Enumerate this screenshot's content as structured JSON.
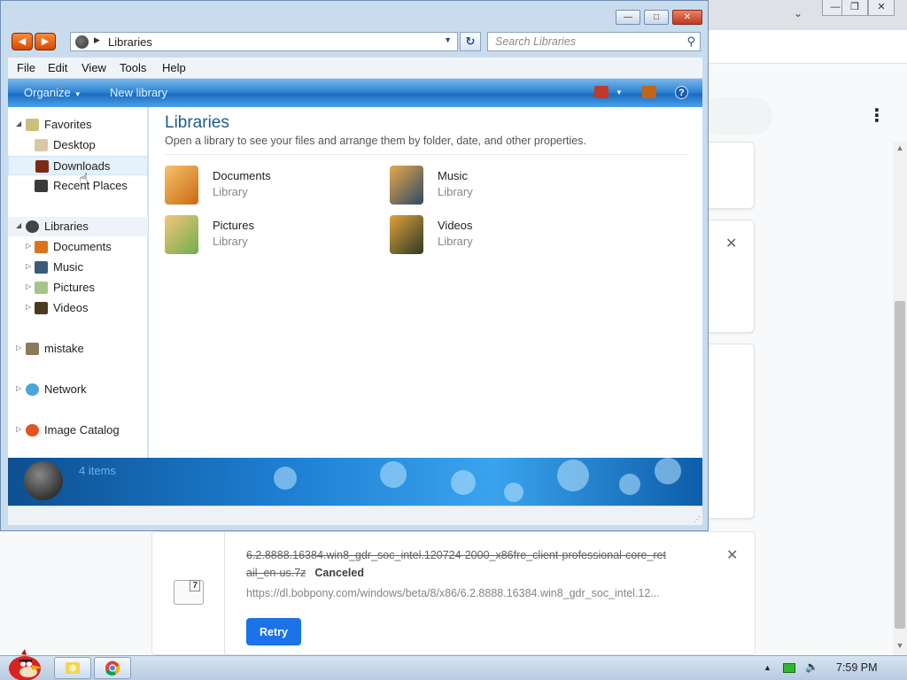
{
  "explorer": {
    "address": {
      "location": "Libraries"
    },
    "search": {
      "placeholder": "Search Libraries"
    },
    "menu": [
      "File",
      "Edit",
      "View",
      "Tools",
      "Help"
    ],
    "command_bar": {
      "organize": "Organize",
      "new_library": "New library"
    },
    "nav": {
      "favorites": "Favorites",
      "favorites_items": [
        "Desktop",
        "Downloads",
        "Recent Places"
      ],
      "libraries": "Libraries",
      "libraries_items": [
        "Documents",
        "Music",
        "Pictures",
        "Videos"
      ],
      "mistake": "mistake",
      "network": "Network",
      "image_catalog": "Image Catalog"
    },
    "content": {
      "title": "Libraries",
      "description": "Open a library to see your files and arrange them by folder, date, and other properties.",
      "items": [
        {
          "name": "Documents",
          "type": "Library"
        },
        {
          "name": "Music",
          "type": "Library"
        },
        {
          "name": "Pictures",
          "type": "Library"
        },
        {
          "name": "Videos",
          "type": "Library"
        }
      ]
    },
    "details": {
      "item_count": "4 items"
    }
  },
  "chrome": {
    "download": {
      "filename_line1": "6.2.8888.16384.win8_gdr_soc_intel.120724-2000_x86fre_client-professional-core_ret",
      "filename_line2": "ail_en-us.7z",
      "status": "Canceled",
      "url": "https://dl.bobpony.com/windows/beta/8/x86/6.2.8888.16384.win8_gdr_soc_intel.12...",
      "retry": "Retry",
      "file_badge": "7"
    }
  },
  "taskbar": {
    "time": "7:59 PM"
  },
  "colors": {
    "accent_blue": "#1a73e8",
    "library_title": "#1e5c8c",
    "command_bar": "#2f86d6"
  }
}
